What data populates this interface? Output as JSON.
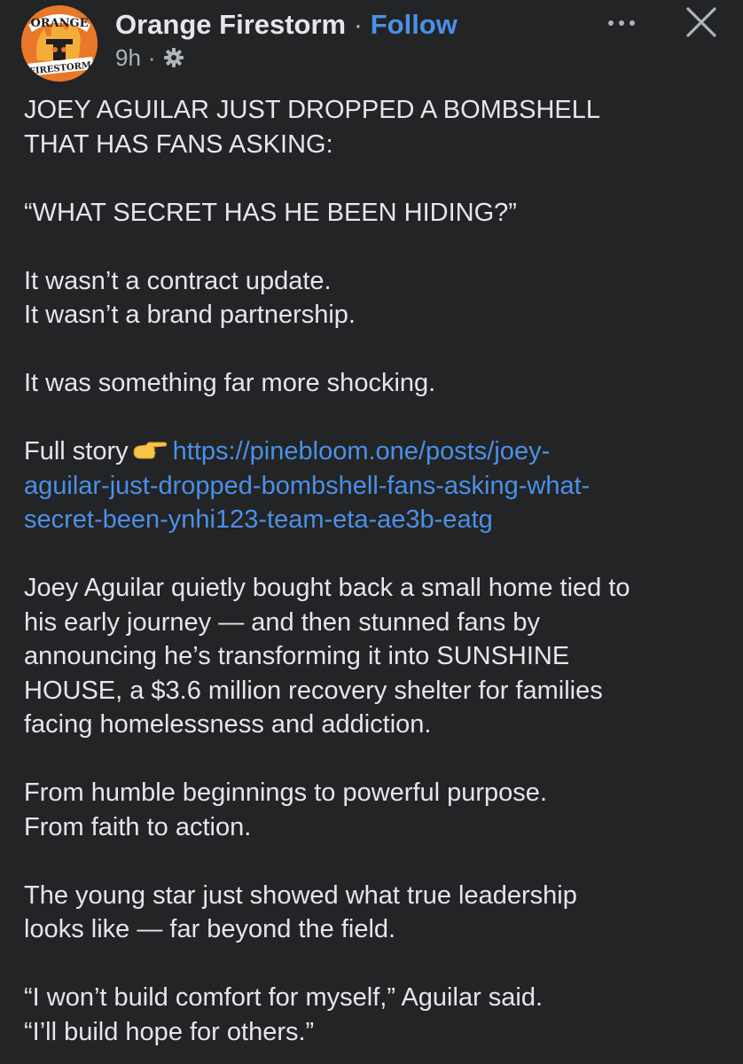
{
  "header": {
    "avatar_text_top": "ORANGE",
    "avatar_text_bottom": "FIRESTORM",
    "page_name": "Orange Firestorm",
    "separator": "·",
    "follow_label": "Follow",
    "time": "9h",
    "meta_separator": "·",
    "audience_icon": "gear-icon",
    "more_icon": "more-dots-icon",
    "close_icon": "close-icon"
  },
  "post": {
    "p1": [
      "JOEY AGUILAR JUST DROPPED A BOMBSHELL",
      "THAT HAS FANS ASKING:"
    ],
    "p2": "“WHAT SECRET HAS HE BEEN HIDING?”",
    "p3": [
      "It wasn’t a contract update.",
      "It wasn’t a brand partnership."
    ],
    "p4": "It was something far more shocking.",
    "full_story_label": "Full story",
    "pointing_icon": "pointing-hand-icon",
    "link_lines": [
      "https://pinebloom.one/posts/joey-",
      "aguilar-just-dropped-bombshell-fans-asking-what-",
      "secret-been-ynhi123-team-eta-ae3b-eatg"
    ],
    "p5": [
      "Joey Aguilar quietly bought back a small home tied to",
      "his early journey — and then stunned fans by",
      "announcing he’s transforming it into SUNSHINE",
      "HOUSE, a $3.6 million recovery shelter for families",
      "facing homelessness and addiction."
    ],
    "p6": [
      "From humble beginnings to powerful purpose.",
      "From faith to action."
    ],
    "p7": [
      "The young star just showed what true leadership",
      "looks like — far beyond the field."
    ],
    "p8": [
      "“I won’t build comfort for myself,” Aguilar said.",
      "“I’ll build hope for others.”"
    ]
  },
  "colors": {
    "background": "#232425",
    "text": "#e4e6eb",
    "secondary": "#b0b3b8",
    "link": "#4a90e8",
    "brand_orange": "#e8782a"
  }
}
